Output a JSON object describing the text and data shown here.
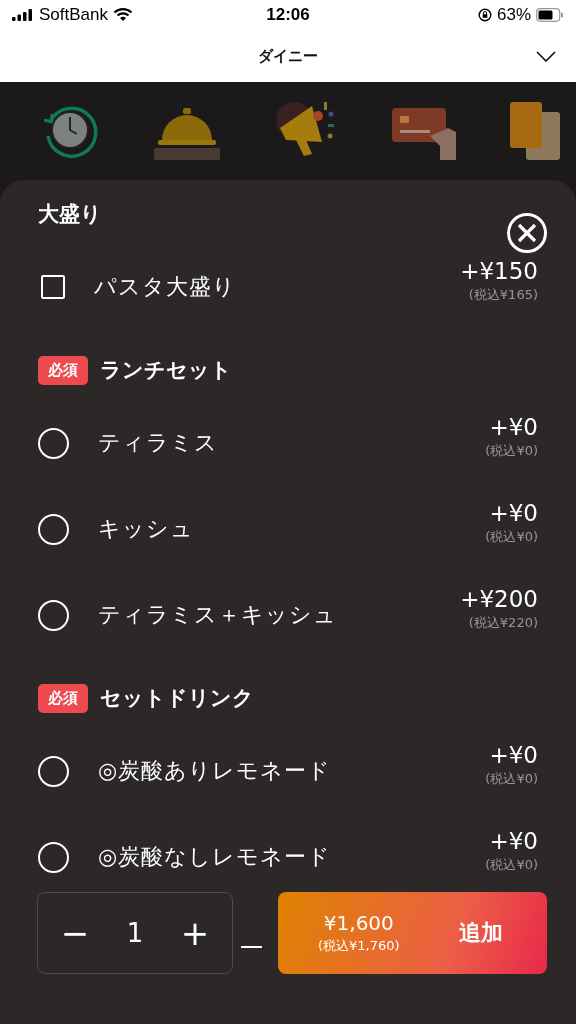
{
  "status_bar": {
    "carrier": "SoftBank",
    "time": "12:06",
    "battery": "63%"
  },
  "header": {
    "title": "ダイニー"
  },
  "sheet": {
    "sections": [
      {
        "title": "大盛り",
        "required": false,
        "options": [
          {
            "kind": "checkbox",
            "label": "パスタ大盛り",
            "price": "+¥150",
            "tax_price": "(税込¥165)",
            "checked": false
          }
        ]
      },
      {
        "title": "ランチセット",
        "required": true,
        "badge": "必須",
        "options": [
          {
            "kind": "radio",
            "label": "ティラミス",
            "price": "+¥0",
            "tax_price": "(税込¥0)",
            "checked": false
          },
          {
            "kind": "radio",
            "label": "キッシュ",
            "price": "+¥0",
            "tax_price": "(税込¥0)",
            "checked": false
          },
          {
            "kind": "radio",
            "label": "ティラミス＋キッシュ",
            "price": "+¥200",
            "tax_price": "(税込¥220)",
            "checked": false
          }
        ]
      },
      {
        "title": "セットドリンク",
        "required": true,
        "badge": "必須",
        "options": [
          {
            "kind": "radio",
            "label": "◎炭酸ありレモネード",
            "price": "+¥0",
            "tax_price": "(税込¥0)",
            "checked": false
          },
          {
            "kind": "radio",
            "label": "◎炭酸なしレモネード",
            "price": "+¥0",
            "tax_price": "(税込¥0)",
            "checked": false
          }
        ]
      }
    ]
  },
  "footer": {
    "minus": "−",
    "quantity": "1",
    "plus": "+",
    "total": "¥1,600",
    "total_tax": "(税込¥1,760)",
    "add_button": "追加"
  }
}
